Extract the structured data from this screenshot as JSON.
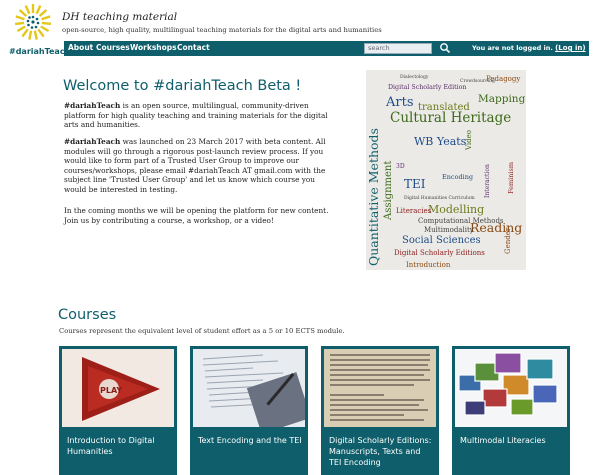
{
  "header": {
    "logo_text": "#dariahTeach",
    "title": "DH teaching material",
    "subtitle": "open-source, high quality, multilingual teaching materials for the digital arts and humanities"
  },
  "nav": {
    "items": [
      "About",
      "Courses",
      "Workshops",
      "Contact"
    ],
    "search_placeholder": "search",
    "login_text": "You are not logged in.",
    "login_link": "(Log in)"
  },
  "welcome": {
    "title": "Welcome to #dariahTeach Beta !",
    "p1_bold": "#dariahTeach",
    "p1_rest": " is an open source, multilingual, community-driven platform for high quality teaching and training materials for the digital arts and humanities.",
    "p2_bold": "#dariahTeach",
    "p2_rest": " was launched on 23 March 2017 with beta content. All modules will go through a rigorous post-launch review process. If you would like to form part of a Trusted User Group to improve our courses/workshops, please email #dariahTeach AT gmail.com with the subject line 'Trusted User Group' and let us know which course you would be interested in testing.",
    "p3": "In the coming months we will be opening the platform for new content. Join us by contributing a course, a workshop, or a video!"
  },
  "wordcloud": {
    "words": [
      "Quantitative Methods",
      "Cultural Heritage",
      "Digital Scholarly Edition",
      "Pedagogy",
      "Arts",
      "translated",
      "Mapping",
      "WB Yeats",
      "TEI",
      "Modelling",
      "Reading",
      "Social Sciences",
      "Digital Scholarly Editions",
      "Introduction",
      "Assignment",
      "Literacies",
      "Computational Methods",
      "Multimodality",
      "Encoding",
      "Interaction",
      "Feminism",
      "Video",
      "Gender",
      "Dialectology",
      "Crowdsourcing",
      "3D",
      "Digital Humanities Curriculum"
    ],
    "colors": {
      "teal": "#0e5f6b",
      "green": "#3d6a1a",
      "olive": "#6b7a1c",
      "brown": "#8a4a12",
      "purple": "#5b2e6e",
      "blue": "#1f4c8a",
      "red": "#8b2121",
      "gray": "#444444"
    }
  },
  "courses": {
    "title": "Courses",
    "subtitle": "Courses represent the equivalent level of student effort as a 5 or 10 ECTS module.",
    "cards": [
      {
        "label": "Introduction to Digital Humanities",
        "image": "play-button-image",
        "image_text": "PLAY"
      },
      {
        "label": "Text Encoding and the TEI",
        "image": "code-printout-image"
      },
      {
        "label": "Digital Scholarly Editions: Manuscripts, Texts and TEI Encoding",
        "image": "manuscript-page-image"
      },
      {
        "label": "Multimodal Literacies",
        "image": "media-screens-image"
      }
    ]
  },
  "colors": {
    "accent": "#0e5f6b",
    "logo_yellow": "#e3c71a"
  }
}
